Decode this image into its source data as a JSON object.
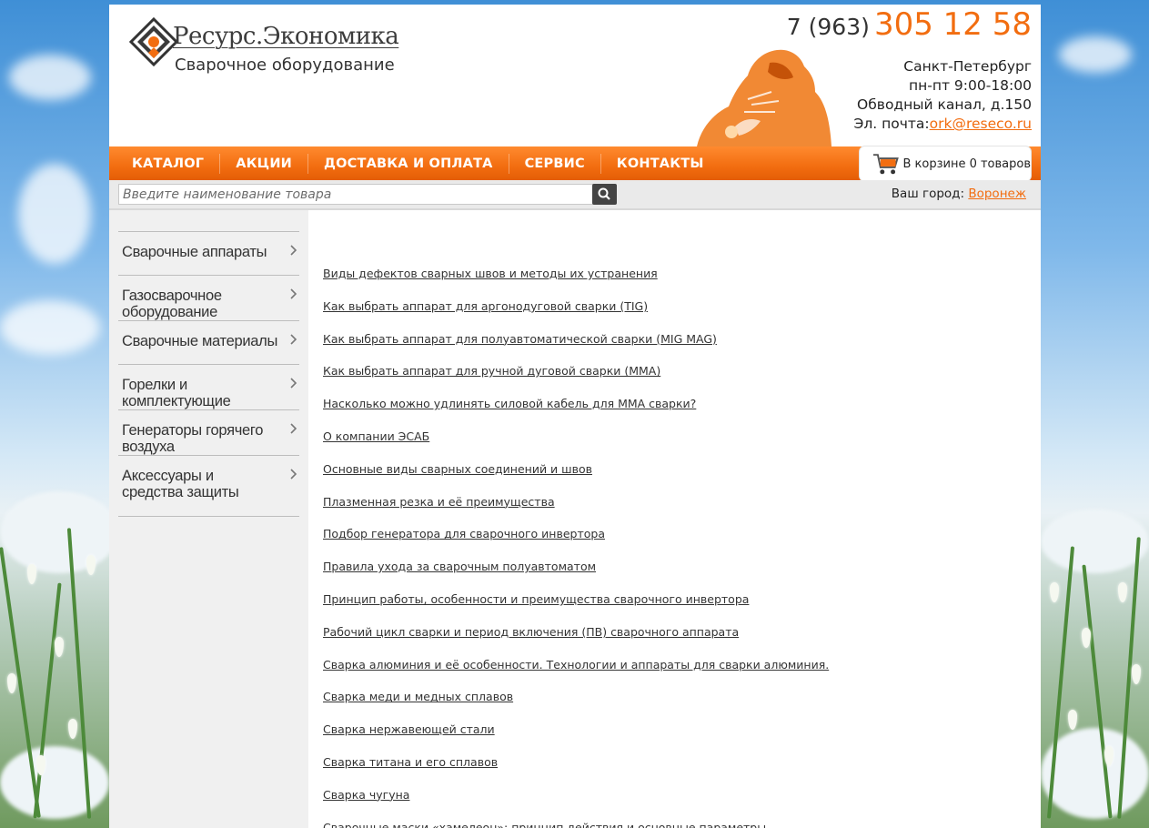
{
  "header": {
    "logo_title": "Ресурс.Экономика",
    "logo_subtitle": "Сварочное оборудование",
    "phone_code": "7 (963)",
    "phone_number": "305 12 58",
    "city_line": "Санкт-Петербург",
    "hours_line": "пн-пт 9:00-18:00",
    "address_line": "Обводный канал, д.150",
    "email_label": "Эл. почта:",
    "email": "ork@reseco.ru"
  },
  "nav": {
    "items": [
      "КАТАЛОГ",
      "АКЦИИ",
      "ДОСТАВКА И ОПЛАТА",
      "СЕРВИС",
      "КОНТАКТЫ"
    ]
  },
  "cart": {
    "label": "В корзине 0 товаров"
  },
  "search": {
    "placeholder": "Введите наименование товара",
    "city_label": "Ваш город:",
    "city_value": "Воронеж"
  },
  "sidebar": {
    "categories": [
      "Сварочные аппараты",
      "Газосварочное оборудование",
      "Сварочные материалы",
      "Горелки и комплектующие",
      "Генераторы горячего воздуха",
      "Аксессуары и средства защиты"
    ]
  },
  "articles": [
    "Виды дефектов сварных швов и методы их устранения",
    "Как выбрать аппарат для аргонодуговой сварки (TIG)",
    "Как выбрать аппарат для полуавтоматической сварки (MIG MAG)",
    "Как выбрать аппарат для ручной дуговой сварки (MMA)",
    "Насколько можно удлинять силовой кабель для MMA сварки?",
    "О компании ЭСАБ",
    "Основные виды сварных соединений и швов",
    "Плазменная резка и её преимущества",
    "Подбор генератора для сварочного инвертора",
    "Правила ухода за сварочным полуавтоматом",
    "Принцип работы, особенности и преимущества сварочного инвертора",
    "Рабочий цикл сварки и период включения (ПВ) сварочного аппарата",
    "Сварка алюминия и её особенности. Технологии и аппараты для сварки алюминия.",
    "Сварка меди и медных сплавов",
    "Сварка нержавеющей стали",
    "Сварка титана и его сплавов",
    "Сварка чугуна",
    "Сварочные маски «хамелеон»: принцип действия и основные параметры"
  ],
  "colors": {
    "accent": "#f26d10",
    "nav_bg": "#f26d10",
    "sidebar_bg": "#f0f0f0",
    "text": "#333333"
  },
  "icons": {
    "logo": "diamond-logo-icon",
    "cart": "shopping-cart-icon",
    "search": "magnifier-icon",
    "chevron": "chevron-right-icon"
  }
}
